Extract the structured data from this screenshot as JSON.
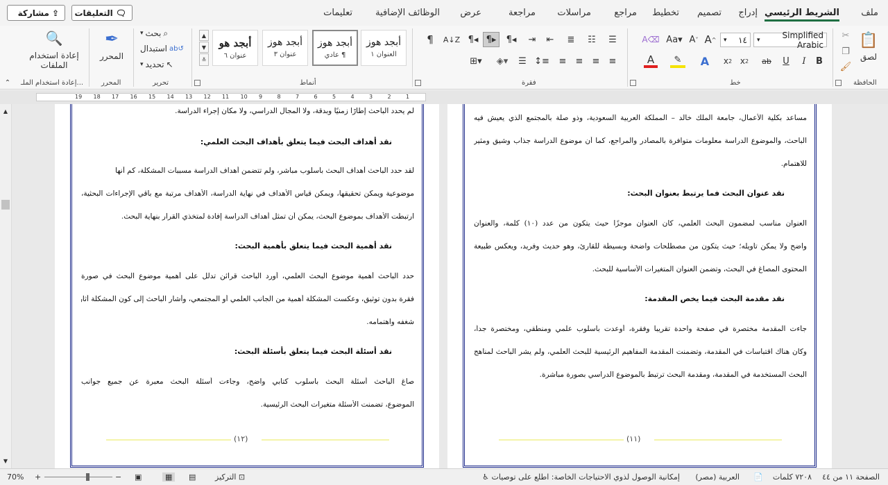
{
  "tabs": {
    "file": "ملف",
    "home": "الشريط الرئيسي",
    "insert": "إدراج",
    "design": "تصميم",
    "layout": "تخطيط",
    "references": "مراجع",
    "mailings": "مراسلات",
    "review": "مراجعة",
    "view": "عرض",
    "addins": "الوظائف الإضافية",
    "help": "تعليمات"
  },
  "top_buttons": {
    "comments": "التعليقات",
    "share": "مشاركة"
  },
  "ribbon": {
    "groups": {
      "clipboard": "الحافظة",
      "font": "خط",
      "paragraph": "فقرة",
      "styles": "أنماط",
      "editing": "تحرير",
      "editor": "المحرر",
      "reuse_files": "إعادة استخدام الملـ..."
    },
    "paste_label": "لصق",
    "font_name": "Simplified Arabic",
    "font_size": "١٤",
    "styles": [
      {
        "sample": "أبجد هوز",
        "name": "العنوان ١"
      },
      {
        "sample": "أبجد هوز",
        "name": "¶ عادي"
      },
      {
        "sample": "أبجد هوز",
        "name": "عنوان ٣"
      },
      {
        "sample": "أبجد هو",
        "name": "عنوان ٦"
      }
    ],
    "find_label": "بحث",
    "replace_label": "استبدال",
    "select_label": "تحديد",
    "editor_label": "المحرر",
    "reuse_label_1": "إعادة استخدام",
    "reuse_label_2": "الملفات"
  },
  "ruler_numbers": [
    "1",
    "2",
    "3",
    "4",
    "5",
    "6",
    "7",
    "8",
    "9",
    "10",
    "11",
    "12",
    "13",
    "14",
    "15",
    "16",
    "17",
    "18",
    "19"
  ],
  "pages": {
    "left": {
      "lines": [
        "لم يحدد الباحث إطارًا زمنيًا وبدقة، ولا المجال الدراسي، ولا مكان إجراء الدراسة.",
        "نقد أهداف البحث فيما يتعلق بأهداف البحث العلمي:",
        "لقد حدد الباحث أهداف البحث بأسلوب مباشر، ولم تتضمن أهداف الدراسة مسببات المشكلة، كم أنها",
        "موضوعية ويمكن تحقيقها، ويمكن قياس الأهداف في نهاية الدراسة، الأهداف مرتبة مع باقي الإجراءات البحثية،",
        "ارتبطت الأهداف بموضوع البحث، يمكن أن تمثل أهداف الدراسة إفادة لمتخذي القرار بنهاية البحث.",
        "نقد أهمية البحث فيما يتعلق بأهمية البحث:",
        "حدد الباحث أهمية موضوع البحث العلمي، أورد الباحث قرائن تدلل على أهمية موضوع البحث في صورة",
        "فقرة بدون توثيق، وعكست المشكلة أهمية من الجانب العلمي أو المجتمعي، وأشار الباحث إلى كون المشكلة أثارت",
        "شغفه واهتمامه.",
        "نقد أسئلة البحث فيما يتعلق بأسئلة البحث:",
        "صاغ الباحث أسئلة البحث بأسلوب كتابي واضح، وجاءت أسئلة البحث معبرة عن جميع جوانب",
        "الموضوع، تضمنت الأسئلة متغيرات البحث الرئيسية."
      ],
      "page_number": "١٢"
    },
    "right": {
      "lines": [
        "مساعد بكلية الأعمال، جامعة الملك خالد – المملكة العربية السعودية، وذو صلة بالمجتمع الذي يعيش فيه",
        "الباحث، والموضوع الدراسة معلومات متوافرة بالمصادر والمراجع، كما أن موضوع الدراسة جذاب وشيق ومثير",
        "للاهتمام.",
        "نقد عنوان البحث فما يرتبط بعنوان البحث:",
        "العنوان مناسب لمضمون البحث العلمي، كان العنوان موجزًا حيث يتكون من عدد (١٠) كلمة، والعنوان",
        "واضح ولا يمكن تأويله؛ حيث يتكون من مصطلحات واضحة وبسيطة للقارئ، وهو حديث وفريد، ويعكس طبيعة",
        "المحتوى المصاغ في البحث، وتضمن العنوان المتغيرات الأساسية للبحث.",
        "نقد مقدمة البحث فيما يخص المقدمة:",
        "جاءت المقدمة مختصرة في صفحة واحدة تقريبا وفقرة، أوعدت بأسلوب علمي ومنطقي، ومختصرة جداً،",
        "وكان هناك اقتباسات في المقدمة، وتضمنت المقدمة المفاهيم الرئيسية للبحث العلمي، ولم يشر الباحث لمناهج",
        "البحث المستخدمة في المقدمة، ومقدمة البحث ترتبط بالموضوع الدراسي بصورة مباشرة."
      ],
      "page_number": "١١"
    }
  },
  "status": {
    "page_info": "الصفحة ١١ من ٤٤",
    "words": "٧٢٠٨ كلمات",
    "language": "العربية (مصر)",
    "accessibility": "إمكانية الوصول لذوي الاحتياجات الخاصة: اطلع على توصيات",
    "focus": "التركيز",
    "zoom": "70%"
  },
  "colors": {
    "accent": "#1e6e42",
    "page_border": "#1d2a8a",
    "font_red": "#e02020",
    "highlight_yellow": "#f5e300"
  }
}
